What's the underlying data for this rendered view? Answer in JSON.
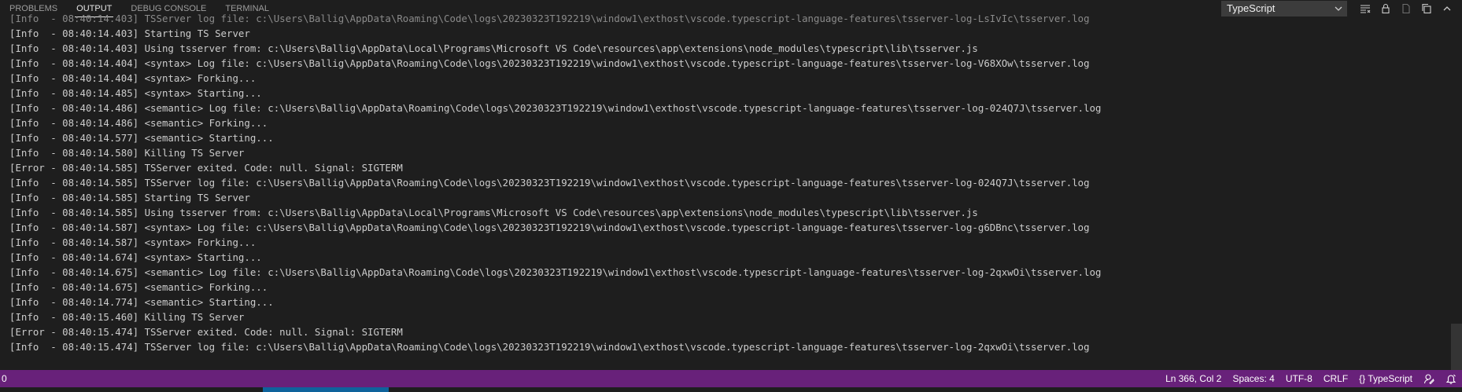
{
  "panel": {
    "tabs": [
      {
        "label": "PROBLEMS"
      },
      {
        "label": "OUTPUT"
      },
      {
        "label": "DEBUG CONSOLE"
      },
      {
        "label": "TERMINAL"
      }
    ],
    "active_tab": "OUTPUT",
    "channel": "TypeScript"
  },
  "output": {
    "lines": [
      "[Info  - 08:40:14.403] TSServer log file: c:\\Users\\Ballig\\AppData\\Roaming\\Code\\logs\\20230323T192219\\window1\\exthost\\vscode.typescript-language-features\\tsserver-log-LsIvIc\\tsserver.log",
      "[Info  - 08:40:14.403] Starting TS Server",
      "[Info  - 08:40:14.403] Using tsserver from: c:\\Users\\Ballig\\AppData\\Local\\Programs\\Microsoft VS Code\\resources\\app\\extensions\\node_modules\\typescript\\lib\\tsserver.js",
      "[Info  - 08:40:14.404] <syntax> Log file: c:\\Users\\Ballig\\AppData\\Roaming\\Code\\logs\\20230323T192219\\window1\\exthost\\vscode.typescript-language-features\\tsserver-log-V68XOw\\tsserver.log",
      "[Info  - 08:40:14.404] <syntax> Forking...",
      "[Info  - 08:40:14.485] <syntax> Starting...",
      "[Info  - 08:40:14.486] <semantic> Log file: c:\\Users\\Ballig\\AppData\\Roaming\\Code\\logs\\20230323T192219\\window1\\exthost\\vscode.typescript-language-features\\tsserver-log-024Q7J\\tsserver.log",
      "[Info  - 08:40:14.486] <semantic> Forking...",
      "[Info  - 08:40:14.577] <semantic> Starting...",
      "[Info  - 08:40:14.580] Killing TS Server",
      "[Error - 08:40:14.585] TSServer exited. Code: null. Signal: SIGTERM",
      "[Info  - 08:40:14.585] TSServer log file: c:\\Users\\Ballig\\AppData\\Roaming\\Code\\logs\\20230323T192219\\window1\\exthost\\vscode.typescript-language-features\\tsserver-log-024Q7J\\tsserver.log",
      "[Info  - 08:40:14.585] Starting TS Server",
      "[Info  - 08:40:14.585] Using tsserver from: c:\\Users\\Ballig\\AppData\\Local\\Programs\\Microsoft VS Code\\resources\\app\\extensions\\node_modules\\typescript\\lib\\tsserver.js",
      "[Info  - 08:40:14.587] <syntax> Log file: c:\\Users\\Ballig\\AppData\\Roaming\\Code\\logs\\20230323T192219\\window1\\exthost\\vscode.typescript-language-features\\tsserver-log-g6DBnc\\tsserver.log",
      "[Info  - 08:40:14.587] <syntax> Forking...",
      "[Info  - 08:40:14.674] <syntax> Starting...",
      "[Info  - 08:40:14.675] <semantic> Log file: c:\\Users\\Ballig\\AppData\\Roaming\\Code\\logs\\20230323T192219\\window1\\exthost\\vscode.typescript-language-features\\tsserver-log-2qxwOi\\tsserver.log",
      "[Info  - 08:40:14.675] <semantic> Forking...",
      "[Info  - 08:40:14.774] <semantic> Starting...",
      "[Info  - 08:40:15.460] Killing TS Server",
      "[Error - 08:40:15.474] TSServer exited. Code: null. Signal: SIGTERM",
      "[Info  - 08:40:15.474] TSServer log file: c:\\Users\\Ballig\\AppData\\Roaming\\Code\\logs\\20230323T192219\\window1\\exthost\\vscode.typescript-language-features\\tsserver-log-2qxwOi\\tsserver.log"
    ]
  },
  "statusbar": {
    "left_text": "0",
    "position": "Ln 366, Col 2",
    "indent": "Spaces: 4",
    "encoding": "UTF-8",
    "eol": "CRLF",
    "language": "{} TypeScript",
    "accent_color": "#68217a"
  }
}
